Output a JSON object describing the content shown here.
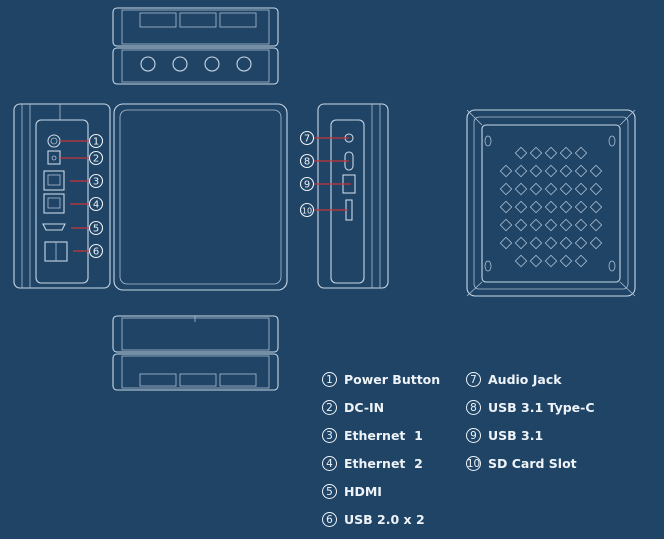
{
  "colors": {
    "background": "#1f4466",
    "line": "#c9d7e6",
    "callout_line": "#c4343a"
  },
  "views": {
    "left_side_callouts": [
      "1",
      "2",
      "3",
      "4",
      "5",
      "6"
    ],
    "right_side_callouts": [
      "7",
      "8",
      "9",
      "10"
    ]
  },
  "legend": {
    "items": [
      {
        "num": "1",
        "label": "Power Button"
      },
      {
        "num": "2",
        "label": "DC-IN"
      },
      {
        "num": "3",
        "label": "Ethernet  1"
      },
      {
        "num": "4",
        "label": "Ethernet  2"
      },
      {
        "num": "5",
        "label": "HDMI"
      },
      {
        "num": "6",
        "label": "USB 2.0 x 2"
      },
      {
        "num": "7",
        "label": "Audio Jack"
      },
      {
        "num": "8",
        "label": "USB 3.1 Type-C"
      },
      {
        "num": "9",
        "label": "USB 3.1"
      },
      {
        "num": "10",
        "label": "SD Card Slot"
      }
    ]
  }
}
